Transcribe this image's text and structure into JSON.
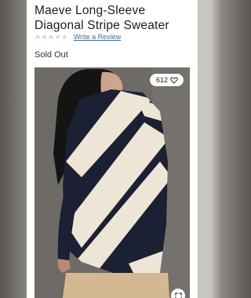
{
  "product": {
    "title": "Maeve Long-Sleeve Diagonal Stripe Sweater",
    "stars_glyphs": "★★★★★",
    "rating_value": 0,
    "rating_max": 5,
    "review_link": "Write a Review",
    "availability": "Sold Out"
  },
  "image": {
    "like_count": "612",
    "heart_icon": "heart-outline-icon",
    "expand_icon": "expand-icon"
  },
  "colors": {
    "sweater_navy": "#1c2033",
    "sweater_cream": "#ede6d6",
    "link": "#3f6fa8"
  }
}
